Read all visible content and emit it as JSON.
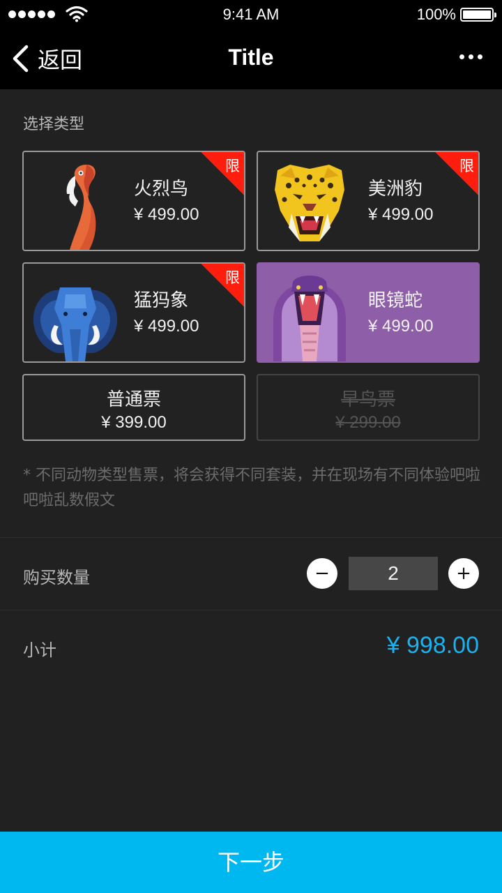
{
  "status_bar": {
    "time": "9:41 AM",
    "battery": "100%"
  },
  "nav": {
    "back_label": "返回",
    "title": "Title"
  },
  "section_label": "选择类型",
  "colors": {
    "accent": "#00b8f0",
    "price_accent": "#1ab3ef",
    "selected_card": "#8e5fa8",
    "limited_corner": "#ff1e0e"
  },
  "animals": [
    {
      "name": "火烈鸟",
      "price": "¥ 499.00",
      "badge": "限",
      "icon": "flamingo-illustration",
      "selected": false
    },
    {
      "name": "美洲豹",
      "price": "¥ 499.00",
      "badge": "限",
      "icon": "jaguar-illustration",
      "selected": false
    },
    {
      "name": "猛犸象",
      "price": "¥ 499.00",
      "badge": "限",
      "icon": "mammoth-illustration",
      "selected": false
    },
    {
      "name": "眼镜蛇",
      "price": "¥ 499.00",
      "icon": "cobra-illustration",
      "selected": true
    }
  ],
  "tickets": [
    {
      "name": "普通票",
      "price": "¥ 399.00",
      "disabled": false
    },
    {
      "name": "早鸟票",
      "price": "¥ 299.00",
      "disabled": true
    }
  ],
  "note": "* 不同动物类型售票，将会获得不同套装，并在现场有不同体验吧啦吧啦乱数假文",
  "quantity": {
    "label": "购买数量",
    "minus": "−",
    "plus": "+",
    "value": "2"
  },
  "subtotal": {
    "label": "小计",
    "value": "¥ 998.00"
  },
  "next_button": "下一步"
}
